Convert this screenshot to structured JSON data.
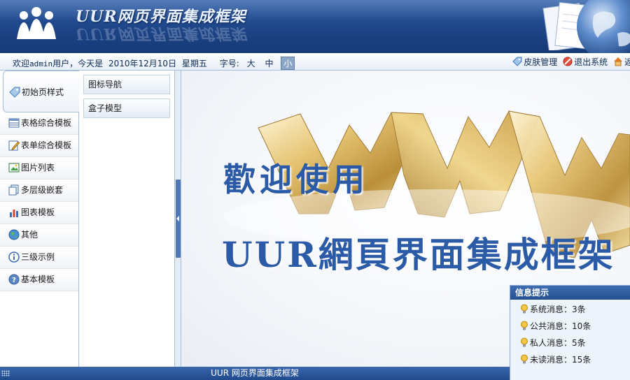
{
  "header": {
    "app_title": "UUR网页界面集成框架",
    "logo_icon": "people-logo-icon",
    "globe_icon": "globe-icon"
  },
  "toolbar": {
    "welcome_prefix": "欢迎",
    "username": "admin",
    "welcome_suffix": "用户，今天是",
    "date": "2010年12月10日",
    "weekday": "星期五",
    "font_size_label": "字号:",
    "font_sizes": [
      "大",
      "中",
      "小"
    ],
    "font_size_selected": "小",
    "skin_label": "皮肤管理",
    "logout_label": "退出系统",
    "back_label": "返"
  },
  "left_nav": {
    "items": [
      {
        "label": "初始页样式",
        "icon": "tag-icon",
        "active": true
      },
      {
        "label": "表格综合模板",
        "icon": "table-icon"
      },
      {
        "label": "表单综合模板",
        "icon": "form-edit-icon"
      },
      {
        "label": "图片列表",
        "icon": "picture-icon"
      },
      {
        "label": "多层级嵌套",
        "icon": "pages-icon"
      },
      {
        "label": "图表模板",
        "icon": "bar-chart-icon"
      },
      {
        "label": "其他",
        "icon": "globe-icon"
      },
      {
        "label": "三级示例",
        "icon": "info-icon"
      },
      {
        "label": "基本模板",
        "icon": "help-icon"
      }
    ]
  },
  "sub_nav": {
    "items": [
      {
        "label": "图标导航"
      },
      {
        "label": "盒子模型"
      }
    ]
  },
  "main": {
    "welcome_line1": "歡迎使用",
    "welcome_line2": "UUR網頁界面集成框架"
  },
  "info_panel": {
    "title": "信息提示",
    "rows": [
      {
        "label": "系统消息：3条"
      },
      {
        "label": "公共消息：10条"
      },
      {
        "label": "私人消息：5条"
      },
      {
        "label": "未读消息：15条"
      }
    ]
  },
  "footer": {
    "text": "UUR 网页界面集成框架"
  },
  "colors": {
    "header_blue": "#1d4486",
    "accent_blue": "#2b5aa6",
    "gold": "#d9b65a"
  }
}
